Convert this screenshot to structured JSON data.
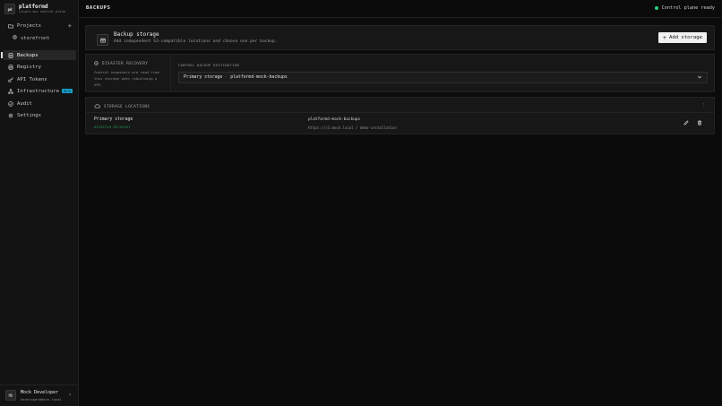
{
  "brand": {
    "logo": "pd",
    "name": "platformd",
    "subtitle": "single-vps control plane"
  },
  "sidebar": {
    "projects_label": "Projects",
    "projects_add": "+",
    "project_items": [
      {
        "label": "storefront",
        "icon": "gear-icon"
      }
    ],
    "items": [
      {
        "label": "Backups",
        "icon": "database-icon",
        "active": true
      },
      {
        "label": "Registry",
        "icon": "registry-icon"
      },
      {
        "label": "API Tokens",
        "icon": "key-icon"
      },
      {
        "label": "Infrastructure",
        "icon": "network-icon",
        "badge": "BETA"
      },
      {
        "label": "Audit",
        "icon": "check-circle-icon"
      },
      {
        "label": "Settings",
        "icon": "gear-icon"
      }
    ]
  },
  "user": {
    "initials": "MD",
    "name": "Mock Developer",
    "email": "developer@mock.local"
  },
  "header": {
    "title": "BACKUPS",
    "status": "Control plane ready",
    "status_color": "#2bd17e"
  },
  "backup_storage": {
    "title": "Backup storage",
    "description": "Add independent S3-compatible locations and choose one per backup.",
    "add_label": "Add storage"
  },
  "disaster_recovery": {
    "heading": "DISASTER RECOVERY",
    "description": "Control snapshots are read from this storage when rebuilding a VPS.",
    "destination_label": "CONTROL BACKUP DESTINATION",
    "destination_name": "Primary storage",
    "destination_separator": "·",
    "destination_bucket": "platformd-mock-backups"
  },
  "storage_locations": {
    "heading": "STORAGE LOCATIONS",
    "rows": [
      {
        "name": "Primary storage",
        "tag": "DISASTER RECOVERY",
        "bucket": "platformd-mock-backups",
        "url": "https://s3.mock.local / demo-installation"
      }
    ]
  },
  "colors": {
    "accent_badge": "#16a0c8",
    "tag_green": "#1f9b59",
    "background": "#0b0b0b"
  }
}
